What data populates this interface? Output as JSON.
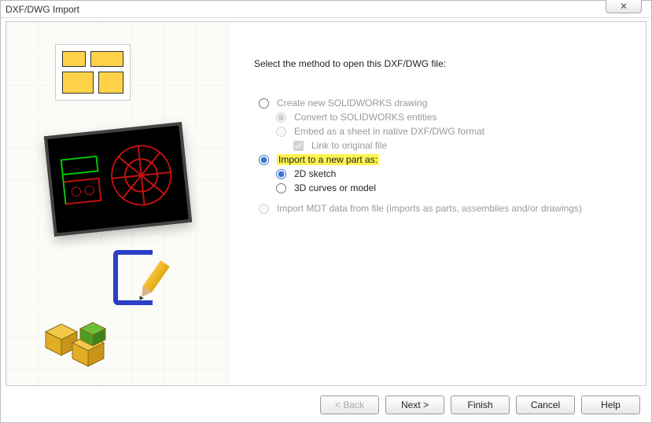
{
  "window": {
    "title": "DXF/DWG Import",
    "close_glyph": "✕"
  },
  "prompt": "Select the method to open this DXF/DWG file:",
  "options": {
    "create_drawing": "Create new SOLIDWORKS drawing",
    "convert_entities": "Convert to SOLIDWORKS entities",
    "embed_sheet": "Embed as a sheet in native DXF/DWG format",
    "link_original": "Link to original file",
    "import_new_part": "Import to a new part as:",
    "sketch_2d": "2D sketch",
    "curves_3d": "3D curves or model",
    "import_mdt": "Import MDT data from file (imports as parts, assemblies and/or drawings)"
  },
  "selection": {
    "top": "import_new_part",
    "create_sub": "convert_entities",
    "link_checked": true,
    "part_sub": "sketch_2d"
  },
  "buttons": {
    "back": "< Back",
    "next": "Next >",
    "finish": "Finish",
    "cancel": "Cancel",
    "help": "Help"
  }
}
